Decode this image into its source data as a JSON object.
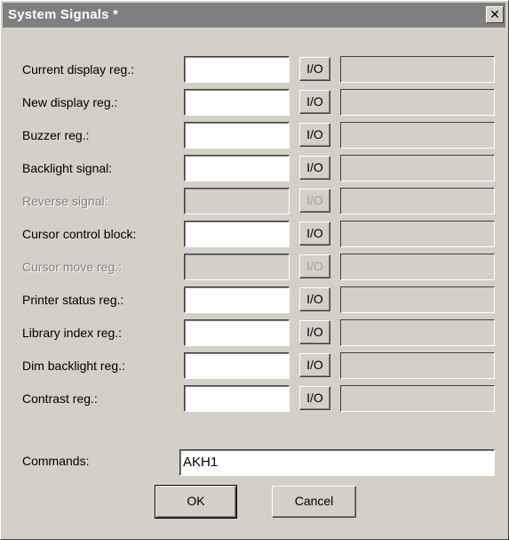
{
  "window": {
    "title": "System Signals *",
    "close_glyph": "✕",
    "close_icon": "close-icon"
  },
  "signals": [
    {
      "label": "Current display reg.:",
      "value": "",
      "io_label": "I/O",
      "display": "",
      "enabled": true
    },
    {
      "label": "New display reg.:",
      "value": "",
      "io_label": "I/O",
      "display": "",
      "enabled": true
    },
    {
      "label": "Buzzer reg.:",
      "value": "",
      "io_label": "I/O",
      "display": "",
      "enabled": true
    },
    {
      "label": "Backlight signal:",
      "value": "",
      "io_label": "I/O",
      "display": "",
      "enabled": true
    },
    {
      "label": "Reverse signal:",
      "value": "",
      "io_label": "I/O",
      "display": "",
      "enabled": false
    },
    {
      "label": "Cursor control block:",
      "value": "",
      "io_label": "I/O",
      "display": "",
      "enabled": true
    },
    {
      "label": "Cursor move reg.:",
      "value": "",
      "io_label": "I/O",
      "display": "",
      "enabled": false
    },
    {
      "label": "Printer status reg.:",
      "value": "",
      "io_label": "I/O",
      "display": "",
      "enabled": true
    },
    {
      "label": "Library index reg.:",
      "value": "",
      "io_label": "I/O",
      "display": "",
      "enabled": true
    },
    {
      "label": "Dim backlight reg.:",
      "value": "",
      "io_label": "I/O",
      "display": "",
      "enabled": true
    },
    {
      "label": "Contrast reg.:",
      "value": "",
      "io_label": "I/O",
      "display": "",
      "enabled": true
    }
  ],
  "commands": {
    "label": "Commands:",
    "value": "AKH1"
  },
  "buttons": {
    "ok": "OK",
    "cancel": "Cancel"
  },
  "colors": {
    "dialog_bg": "#d4d0c8",
    "titlebar_bg": "#7f7f7f",
    "disabled_text": "#808080"
  }
}
